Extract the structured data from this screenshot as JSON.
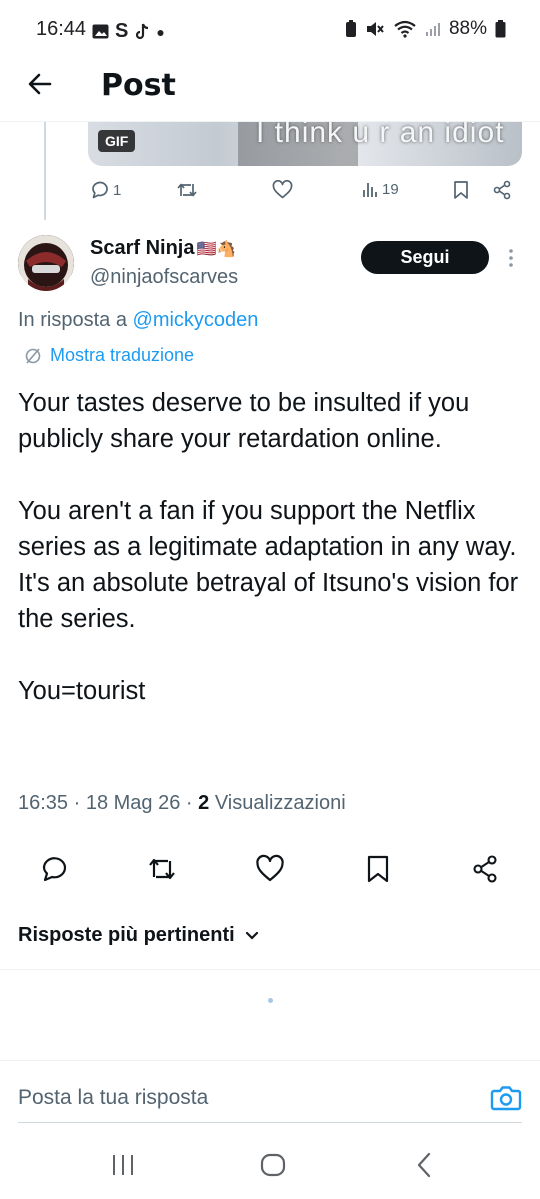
{
  "status_bar": {
    "time": "16:44",
    "battery": "88%",
    "icons_left": [
      "image-icon",
      "s-icon",
      "tiktok-icon",
      "dot-icon"
    ],
    "icons_right": [
      "battery-saver-icon",
      "mute-icon",
      "wifi-icon",
      "signal-icon",
      "battery-icon"
    ]
  },
  "header": {
    "title": "Post"
  },
  "previous_post": {
    "gif_badge": "GIF",
    "gif_caption": "I think u r an idiot",
    "replies": "1",
    "reposts": "",
    "likes": "",
    "views": "19"
  },
  "post": {
    "display_name": "Scarf Ninja",
    "name_emoji": "🇺🇸🐴",
    "username": "@ninjaofscarves",
    "follow_label": "Segui",
    "reply_to_prefix": "In risposta a",
    "reply_to_user": "@mickycoden",
    "translate_label": "Mostra traduzione",
    "paragraphs": [
      "Your tastes deserve to be insulted if you publicly share your retardation online.",
      "You aren't a fan if you support the Netflix series as a legitimate adaptation in any way.  It's an absolute betrayal of Itsuno's vision for the series.",
      "You=tourist"
    ],
    "time": "16:35",
    "date": "18 Mag 26",
    "views_count": "2",
    "views_label": "Visualizzazioni"
  },
  "replies_section": {
    "sort_label": "Risposte più pertinenti"
  },
  "reply_composer": {
    "placeholder": "Posta la tua risposta"
  },
  "colors": {
    "accent": "#1d9bf0",
    "text": "#0f1419",
    "secondary": "#536471",
    "follow_bg": "#0f1419"
  }
}
